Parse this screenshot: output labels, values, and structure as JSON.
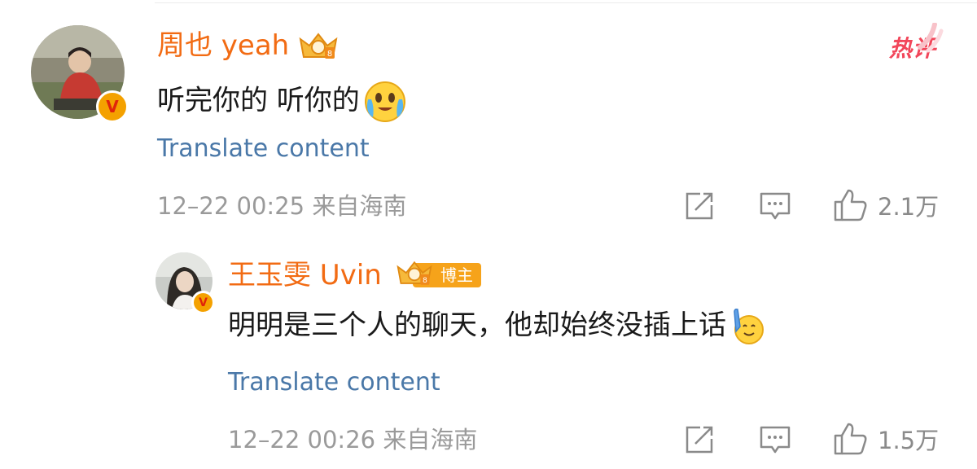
{
  "comments": [
    {
      "username": "周也 yeah",
      "hot_label": "热评",
      "text": "听完你的 听你的",
      "emoji": "smiling-tears-emoji",
      "translate_label": "Translate content",
      "meta": "12–22 00:25 来自海南",
      "likes": "2.1万",
      "verified_badge": "V"
    },
    {
      "username": "王玉雯 Uvin",
      "role_badge": "博主",
      "text": "明明是三个人的聊天，他却始终没插上话",
      "emoji": "raising-hand-emoji",
      "translate_label": "Translate content",
      "meta": "12–22 00:26 来自海南",
      "likes": "1.5万",
      "verified_badge": "V"
    }
  ],
  "colors": {
    "username": "#f26b13",
    "translate": "#4a78a8",
    "meta": "#9a9a9a",
    "hot": "#f2465a",
    "badge": "#f4a100"
  }
}
